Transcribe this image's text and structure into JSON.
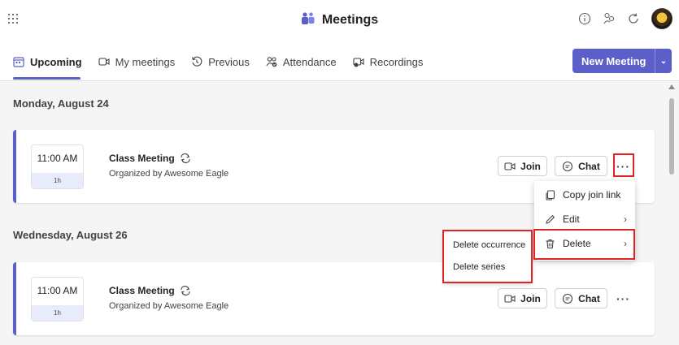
{
  "app": {
    "title": "Meetings"
  },
  "tabs": [
    {
      "label": "Upcoming",
      "icon": "calendar-icon",
      "active": true
    },
    {
      "label": "My meetings",
      "icon": "video-icon"
    },
    {
      "label": "Previous",
      "icon": "history-icon"
    },
    {
      "label": "Attendance",
      "icon": "people-check-icon"
    },
    {
      "label": "Recordings",
      "icon": "recording-icon"
    }
  ],
  "new_meeting": {
    "label": "New Meeting"
  },
  "days": [
    {
      "date": "Monday, August 24",
      "meeting": {
        "time": "11:00 AM",
        "duration": "1h",
        "title": "Class Meeting",
        "organizer": "Organized by Awesome Eagle",
        "join": "Join",
        "chat": "Chat",
        "more": "···"
      }
    },
    {
      "date": "Wednesday, August 26",
      "meeting": {
        "time": "11:00 AM",
        "duration": "1h",
        "title": "Class Meeting",
        "organizer": "Organized by Awesome Eagle",
        "join": "Join",
        "chat": "Chat",
        "more": "···"
      }
    }
  ],
  "context_menu": {
    "items": [
      {
        "label": "Copy join link",
        "icon": "copy-icon"
      },
      {
        "label": "Edit",
        "icon": "pencil-icon",
        "submenu": true
      },
      {
        "label": "Delete",
        "icon": "trash-icon",
        "submenu": true
      }
    ]
  },
  "delete_submenu": {
    "items": [
      "Delete occurrence",
      "Delete series"
    ]
  },
  "colors": {
    "accent": "#5b5fc7",
    "highlight": "#e02424"
  }
}
